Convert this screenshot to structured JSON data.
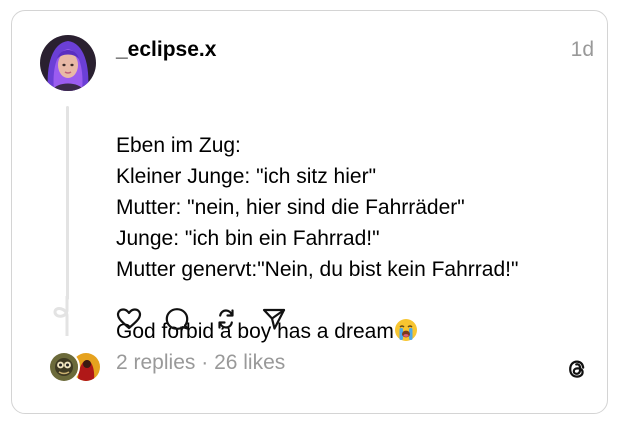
{
  "post": {
    "username": "_eclipse.x",
    "timestamp": "1d",
    "lines": [
      "Eben im Zug:",
      "Kleiner Junge: \"ich sitz hier\"",
      "Mutter: \"nein, hier sind die Fahrräder\"",
      "Junge: \"ich bin ein Fahrrad!\"",
      "Mutter genervt:\"Nein, du bist kein Fahrrad!\"",
      "",
      "God forbid a boy has a dream"
    ],
    "final_emoji": "loudly-crying-face-emoji"
  },
  "actions": {
    "like": "heart-icon",
    "comment": "speech-bubble-icon",
    "repost": "repost-icon",
    "share": "paper-plane-icon"
  },
  "footer": {
    "replies": "2 replies",
    "separator": " · ",
    "likes": "26 likes",
    "logo": "threads-logo-icon"
  },
  "colors": {
    "text": "#000000",
    "muted": "#999999",
    "border": "#d4d4d4",
    "thread_line": "#e3e3e3",
    "avatar_hair": "#7b3fd0"
  }
}
